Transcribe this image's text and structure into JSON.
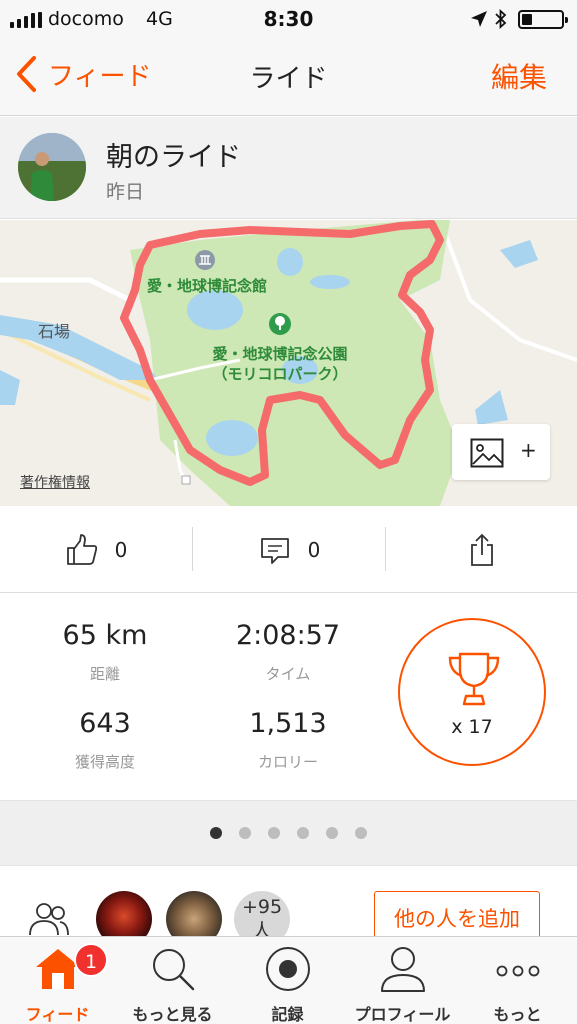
{
  "status_bar": {
    "carrier": "docomo",
    "network": "4G",
    "time": "8:30"
  },
  "nav": {
    "back_label": "フィード",
    "title": "ライド",
    "edit_label": "編集"
  },
  "activity": {
    "name": "朝のライド",
    "date": "昨日"
  },
  "map": {
    "poi_museum": "愛・地球博記念館",
    "poi_park_line1": "愛・地球博記念公園",
    "poi_park_line2": "（モリコロパーク）",
    "place_town": "石場",
    "copyright": "著作権情報",
    "add_photo_plus": "+",
    "route_color": "#f56a6a",
    "park_color": "#cde8b4",
    "water_color": "#a8d4f0"
  },
  "social": {
    "kudos_count": "0",
    "comment_count": "0"
  },
  "stats": {
    "distance": {
      "value": "65 km",
      "label": "距離"
    },
    "time": {
      "value": "2:08:57",
      "label": "タイム"
    },
    "elevation": {
      "value": "643",
      "label": "獲得高度"
    },
    "calories": {
      "value": "1,513",
      "label": "カロリー"
    },
    "achievements": "x 17"
  },
  "pager": {
    "pages": 6,
    "current": 0
  },
  "kudos": {
    "more_label": "+95\n人",
    "add_button": "他の人を追加"
  },
  "tabs": [
    {
      "label": "フィード",
      "icon": "home-icon",
      "active": true,
      "badge": "1"
    },
    {
      "label": "もっと見る",
      "icon": "search-icon",
      "active": false
    },
    {
      "label": "記録",
      "icon": "record-icon",
      "active": false
    },
    {
      "label": "プロフィール",
      "icon": "person-icon",
      "active": false
    },
    {
      "label": "もっと",
      "icon": "more-icon",
      "active": false
    }
  ],
  "colors": {
    "accent": "#fc5200",
    "badge": "#f0312e"
  }
}
